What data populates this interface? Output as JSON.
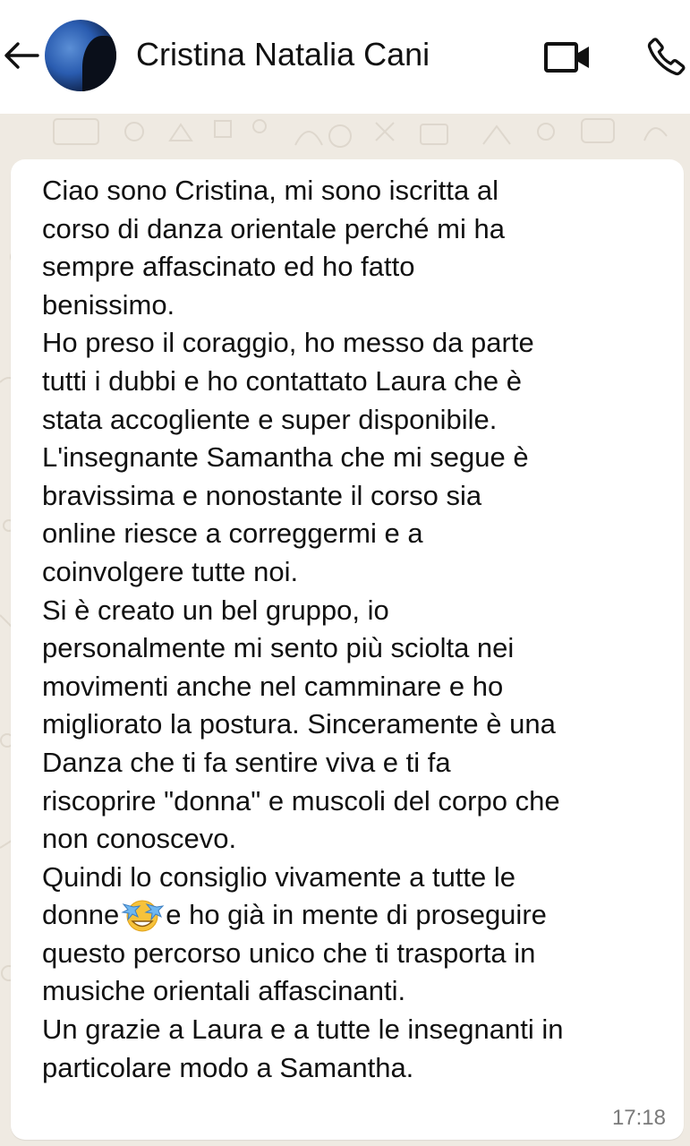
{
  "header": {
    "contact_name": "Cristina Natalia Cani",
    "back_icon": "arrow-left-icon",
    "avatar_icon": "contact-avatar",
    "video_icon": "video-call-icon",
    "phone_icon": "phone-call-icon"
  },
  "message": {
    "text_part1": "Ciao sono Cristina, mi sono iscritta al\ncorso di danza orientale perché mi ha\nsempre affascinato ed ho fatto\nbenissimo.\n Ho preso il coraggio, ho messo da parte\ntutti i dubbi e ho contattato Laura che è\nstata accogliente e super disponibile.\nL'insegnante Samantha che mi segue è\nbravissima e nonostante il corso sia\nonline riesce  a correggermi e a\ncoinvolgere tutte noi.\nSi è creato un bel gruppo, io\npersonalmente mi sento più sciolta nei\nmovimenti anche nel camminare e  ho\nmigliorato la postura. Sinceramente è una\nDanza che ti fa sentire viva e ti fa\nriscoprire \"donna\" e muscoli del corpo che\nnon conoscevo.\nQuindi  lo consiglio vivamente a tutte le\ndonne",
    "emoji_icon": "star-struck-emoji",
    "text_part2": "e ho già in mente di proseguire\nquesto percorso unico che ti trasporta in\nmusiche orientali affascinanti.\nUn grazie a Laura e a tutte le insegnanti in\nparticolare modo a Samantha.",
    "time": "17:18"
  },
  "colors": {
    "header_bg": "#ffffff",
    "chat_bg": "#efeae2",
    "bubble_bg": "#ffffff",
    "text": "#111111",
    "time": "#7a7a7a"
  }
}
